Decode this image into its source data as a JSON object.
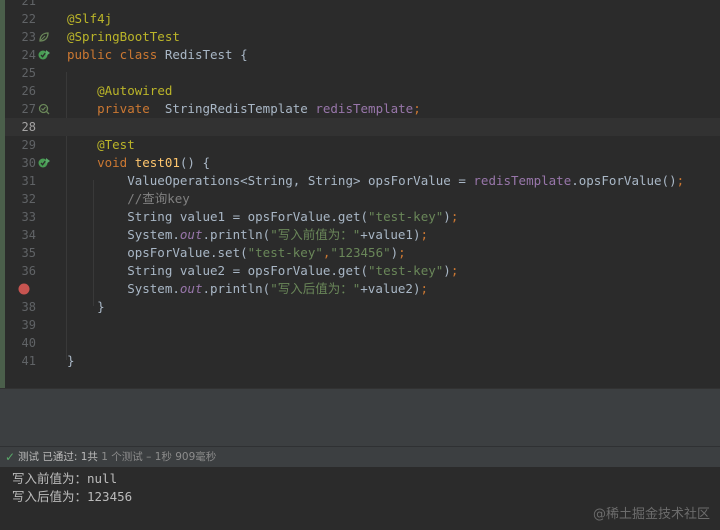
{
  "editor": {
    "lines": [
      {
        "num": "21",
        "text": ""
      },
      {
        "num": "22",
        "text": "@Slf4j"
      },
      {
        "num": "23",
        "text": "@SpringBootTest"
      },
      {
        "num": "24",
        "text": "public class RedisTest {"
      },
      {
        "num": "25",
        "text": ""
      },
      {
        "num": "26",
        "text": "    @Autowired"
      },
      {
        "num": "27",
        "text": "    private  StringRedisTemplate redisTemplate;"
      },
      {
        "num": "28",
        "text": ""
      },
      {
        "num": "29",
        "text": "    @Test"
      },
      {
        "num": "30",
        "text": "    void test01() {"
      },
      {
        "num": "31",
        "text": "        ValueOperations<String, String> opsForValue = redisTemplate.opsForValue();"
      },
      {
        "num": "32",
        "text": "        //查询key"
      },
      {
        "num": "33",
        "text": "        String value1 = opsForValue.get(\"test-key\");"
      },
      {
        "num": "34",
        "text": "        System.out.println(\"写入前值为：\"+value1);"
      },
      {
        "num": "35",
        "text": "        opsForValue.set(\"test-key\",\"123456\");"
      },
      {
        "num": "36",
        "text": "        String value2 = opsForValue.get(\"test-key\");"
      },
      {
        "num": "37",
        "text": ""
      },
      {
        "num": "38",
        "text": "    }"
      },
      {
        "num": "39",
        "text": ""
      },
      {
        "num": "40",
        "text": ""
      },
      {
        "num": "41",
        "text": "}"
      }
    ],
    "line_37_code": "        System.out.println(\"写入后值为：\"+value2);",
    "current_line": "28",
    "gutter_icons": {
      "23": "spring-bean-icon",
      "24": "run-test-class-icon",
      "27": "autowired-bean-icon",
      "30": "run-test-method-icon",
      "37": "breakpoint-icon"
    }
  },
  "status": {
    "test_label": "测试",
    "passed_label": "已通过:",
    "passed_count": "1共",
    "summary": "1 个测试 – 1秒 909毫秒"
  },
  "console": {
    "lines": [
      "写入前值为：null",
      "写入后值为：123456"
    ]
  },
  "watermark": "@稀土掘金技术社区",
  "colors": {
    "editor_bg": "#2b2b2b",
    "keyword": "#cc7832",
    "annotation": "#bbb529",
    "string": "#6a8759",
    "method_decl": "#ffc66d",
    "field": "#9876aa",
    "comment": "#808080",
    "check_green": "#59a869",
    "breakpoint_red": "#c75450"
  }
}
